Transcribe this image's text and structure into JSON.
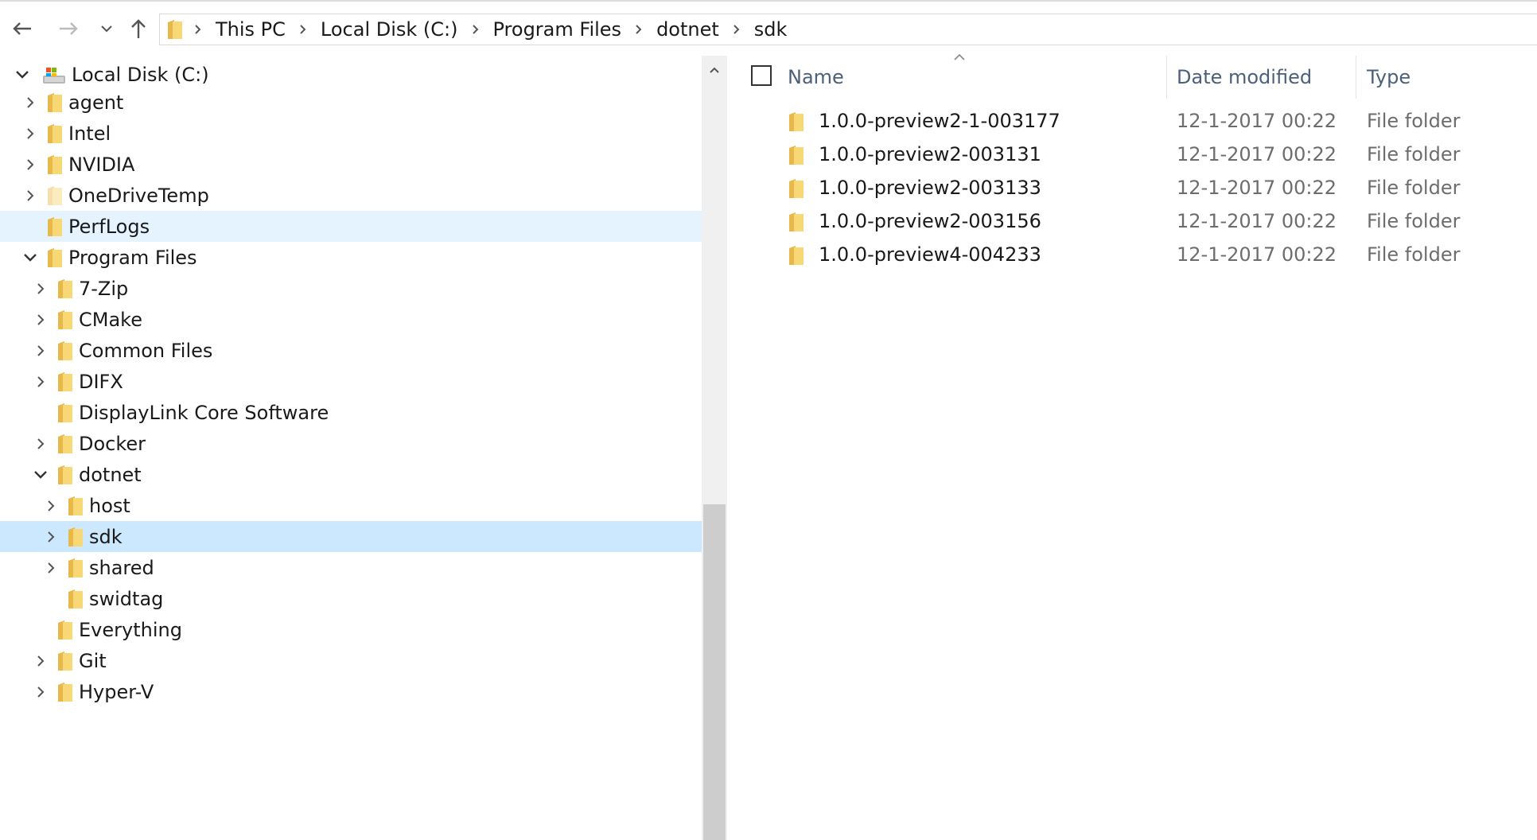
{
  "navigation": {
    "back_icon": "arrow-left-icon",
    "forward_icon": "arrow-right-icon",
    "recent_icon": "chevron-down-icon",
    "up_icon": "arrow-up-icon"
  },
  "breadcrumb": [
    "This PC",
    "Local Disk (C:)",
    "Program Files",
    "dotnet",
    "sdk"
  ],
  "tree": {
    "drive_label": "Local Disk (C:)",
    "items": [
      {
        "label": "agent"
      },
      {
        "label": "Intel"
      },
      {
        "label": "NVIDIA"
      },
      {
        "label": "OneDriveTemp"
      },
      {
        "label": "PerfLogs"
      },
      {
        "label": "Program Files"
      },
      {
        "label": "7-Zip"
      },
      {
        "label": "CMake"
      },
      {
        "label": "Common Files"
      },
      {
        "label": "DIFX"
      },
      {
        "label": "DisplayLink Core Software"
      },
      {
        "label": "Docker"
      },
      {
        "label": "dotnet"
      },
      {
        "label": "host"
      },
      {
        "label": "sdk"
      },
      {
        "label": "shared"
      },
      {
        "label": "swidtag"
      },
      {
        "label": "Everything"
      },
      {
        "label": "Git"
      },
      {
        "label": "Hyper-V"
      }
    ]
  },
  "columns": {
    "name": "Name",
    "date_modified": "Date modified",
    "type": "Type"
  },
  "files": [
    {
      "name": "1.0.0-preview2-1-003177",
      "date": "12-1-2017 00:22",
      "type": "File folder"
    },
    {
      "name": "1.0.0-preview2-003131",
      "date": "12-1-2017 00:22",
      "type": "File folder"
    },
    {
      "name": "1.0.0-preview2-003133",
      "date": "12-1-2017 00:22",
      "type": "File folder"
    },
    {
      "name": "1.0.0-preview2-003156",
      "date": "12-1-2017 00:22",
      "type": "File folder"
    },
    {
      "name": "1.0.0-preview4-004233",
      "date": "12-1-2017 00:22",
      "type": "File folder"
    }
  ],
  "colors": {
    "selected": "#cce8ff",
    "hover": "#e5f3ff",
    "folder": "#f8d775",
    "header_text": "#4c607a"
  }
}
